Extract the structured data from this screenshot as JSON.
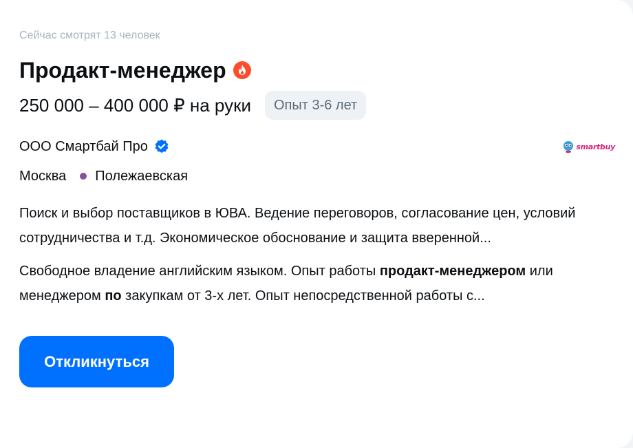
{
  "viewers_text": "Сейчас смотрят 13 человек",
  "vacancy": {
    "title": "Продакт-менеджер",
    "salary": "250 000 – 400 000 ₽ на руки",
    "experience_badge": "Опыт 3-6 лет"
  },
  "company": {
    "name": "ООО Смартбай Про",
    "logo_text": "smartbuy"
  },
  "location": {
    "city": "Москва",
    "metro": "Полежаевская"
  },
  "snippets": {
    "responsibility": "Поиск и выбор поставщиков в ЮВА. Ведение переговоров, согласование цен, условий сотрудничества и т.д. Экономическое обоснование и защита вверенной...",
    "requirement": {
      "part1": "Свободное владение английским языком. Опыт работы ",
      "bold1": "продакт-менеджером",
      "part2": " или менеджером ",
      "bold2": "по",
      "part3": " закупкам от 3-х лет. Опыт непосредственной работы с..."
    }
  },
  "actions": {
    "apply_label": "Откликнуться"
  },
  "colors": {
    "primary": "#0070ff",
    "fire": "#ff4d2b",
    "verified": "#0070ff",
    "metro_line": "#8a4f9c",
    "muted": "#a7b4bf"
  },
  "icons": {
    "hot": "fire-icon",
    "verified": "verified-check-icon"
  }
}
